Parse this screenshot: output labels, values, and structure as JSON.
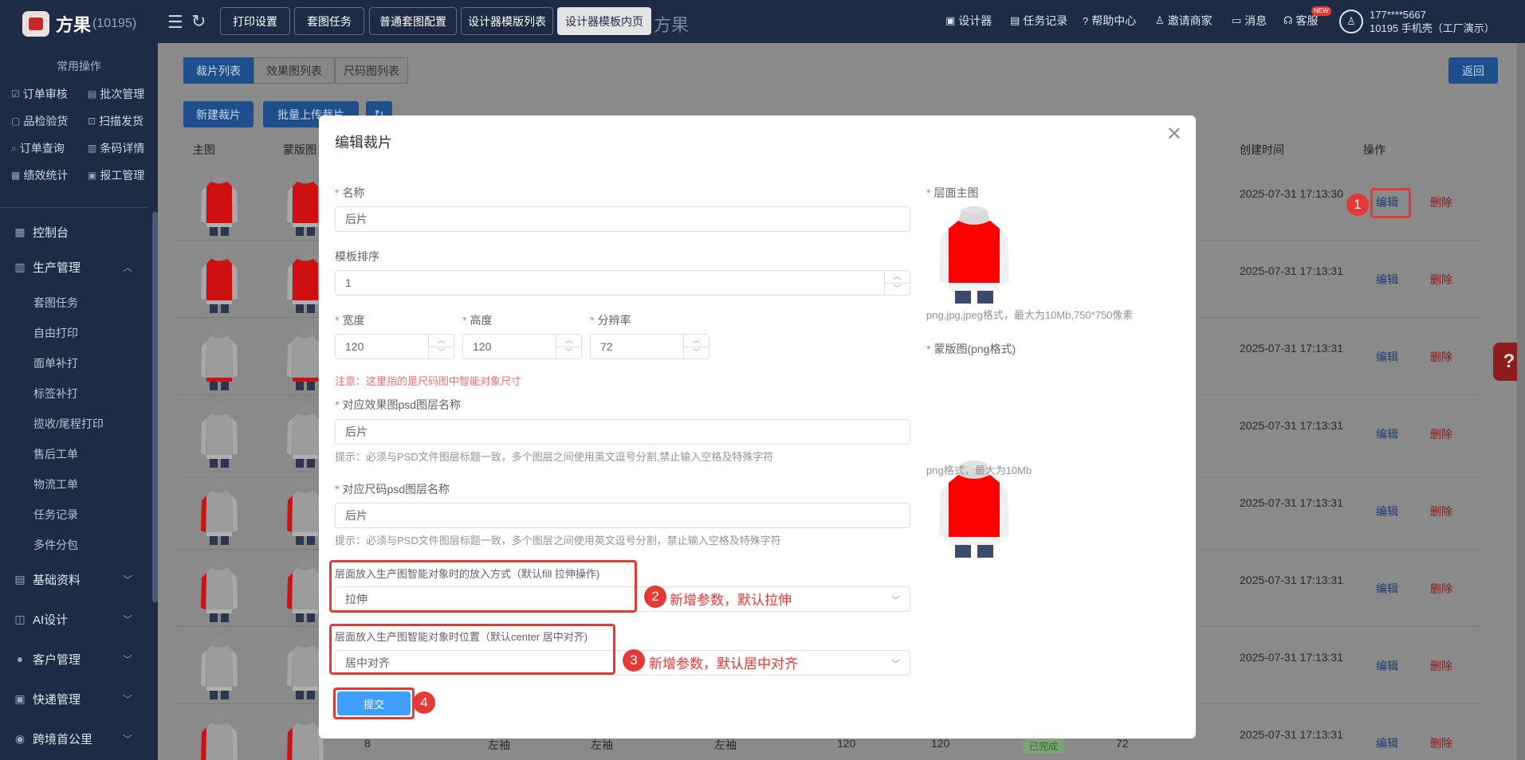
{
  "app": {
    "name": "方果",
    "count": "(10195)"
  },
  "sidebar": {
    "common_title": "常用操作",
    "quick_actions": [
      {
        "label": "订单审核",
        "icon": "check-square-icon"
      },
      {
        "label": "批次管理",
        "icon": "list-icon"
      },
      {
        "label": "品检验货",
        "icon": "clipboard-icon"
      },
      {
        "label": "扫描发货",
        "icon": "scan-icon"
      },
      {
        "label": "订单查询",
        "icon": "search-doc-icon"
      },
      {
        "label": "条码详情",
        "icon": "barcode-icon"
      },
      {
        "label": "绩效统计",
        "icon": "chart-icon"
      },
      {
        "label": "报工管理",
        "icon": "report-icon"
      }
    ],
    "menus": [
      {
        "label": "控制台",
        "icon": "dashboard-icon"
      },
      {
        "label": "生产管理",
        "icon": "production-icon",
        "expanded": true
      },
      {
        "label": "基础资料",
        "icon": "database-icon"
      },
      {
        "label": "AI设计",
        "icon": "ai-icon"
      },
      {
        "label": "客户管理",
        "icon": "customer-icon"
      },
      {
        "label": "快递管理",
        "icon": "express-icon"
      },
      {
        "label": "跨境首公里",
        "icon": "crossborder-icon"
      }
    ],
    "submenus": [
      "套图任务",
      "自由打印",
      "面单补打",
      "标签补打",
      "揽收/尾程打印",
      "售后工单",
      "物流工单",
      "任务记录",
      "多件分包"
    ]
  },
  "topbar": {
    "buttons": [
      "打印设置",
      "套图任务",
      "普通套图配置",
      "设计器模版列表",
      "设计器模板内页"
    ],
    "active_button": "设计器模板内页",
    "faded_title": "方果",
    "right_items": [
      {
        "label": "设计器",
        "icon": "image-icon"
      },
      {
        "label": "任务记录",
        "icon": "task-icon"
      },
      {
        "label": "帮助中心",
        "icon": "help-icon"
      },
      {
        "label": "邀请商家",
        "icon": "invite-icon"
      },
      {
        "label": "消息",
        "icon": "message-icon"
      },
      {
        "label": "客服",
        "icon": "headset-icon"
      }
    ],
    "new_badge": "NEW",
    "user_line1": "177****5667",
    "user_line2": "10195 手机壳（工厂演示）"
  },
  "page": {
    "tabs": [
      "裁片列表",
      "效果图列表",
      "尺码图列表"
    ],
    "back_button": "返回",
    "new_button": "新建裁片",
    "batch_button": "批量上传裁片",
    "columns": {
      "main": "主图",
      "mask": "蒙版图",
      "created": "创建时间",
      "ops": "操作"
    },
    "rows": [
      {
        "created": "2025-07-31 17:13:30",
        "edit": "编辑",
        "del": "删除"
      },
      {
        "created": "2025-07-31 17:13:31",
        "edit": "编辑",
        "del": "删除"
      },
      {
        "created": "2025-07-31 17:13:31",
        "edit": "编辑",
        "del": "删除"
      },
      {
        "created": "2025-07-31 17:13:31",
        "edit": "编辑",
        "del": "删除"
      },
      {
        "created": "2025-07-31 17:13:31",
        "edit": "编辑",
        "del": "删除"
      },
      {
        "created": "2025-07-31 17:13:31",
        "edit": "编辑",
        "del": "删除"
      },
      {
        "created": "2025-07-31 17:13:31",
        "edit": "编辑",
        "del": "删除"
      },
      {
        "created": "2025-07-31 17:13:31",
        "edit": "编辑",
        "del": "删除"
      }
    ],
    "last_row": {
      "sort": "8",
      "name": "左袖",
      "psd": "左袖",
      "size_psd": "左袖",
      "w": "120",
      "h": "120",
      "status": "已完成",
      "dpi": "72"
    }
  },
  "modal": {
    "title": "编辑裁片",
    "name_label": "名称",
    "name_value": "后片",
    "sort_label": "模板排序",
    "sort_value": "1",
    "width_label": "宽度",
    "width_value": "120",
    "height_label": "高度",
    "height_value": "120",
    "dpi_label": "分辨率",
    "dpi_value": "72",
    "size_warning": "注意：这里指的是尺码图中智能对象尺寸",
    "effect_psd_label": "对应效果图psd图层名称",
    "effect_psd_value": "后片",
    "effect_psd_hint": "提示：必须与PSD文件图层标题一致，多个图层之间使用英文逗号分割,禁止输入空格及特殊字符",
    "size_psd_label": "对应尺码psd图层名称",
    "size_psd_value": "后片",
    "size_psd_hint": "提示：必须与PSD文件图层标题一致，多个图层之间使用英文逗号分割，禁止输入空格及特殊字符",
    "fill_mode_label": "层面放入生产图智能对象时的放入方式（默认fill 拉伸操作)",
    "fill_mode_value": "拉伸",
    "position_label": "层面放入生产图智能对象时位置（默认center 居中对齐)",
    "position_value": "居中对齐",
    "submit": "提交",
    "main_image_label": "层面主图",
    "main_image_hint": "png,jpg,jpeg格式，最大为10Mb,750*750像素",
    "mask_image_label": "蒙版图(png格式)",
    "mask_image_hint": "png格式，最大为10Mb"
  },
  "annotations": {
    "n1": "1",
    "n2": "2",
    "n3": "3",
    "n4": "4",
    "text2": "新增参数，默认拉伸",
    "text3": "新增参数，默认居中对齐"
  },
  "colors": {
    "sidebar": "#1d2b45",
    "primary": "#409eff",
    "annotation": "#e53935",
    "garment_red": "#ff0000"
  }
}
